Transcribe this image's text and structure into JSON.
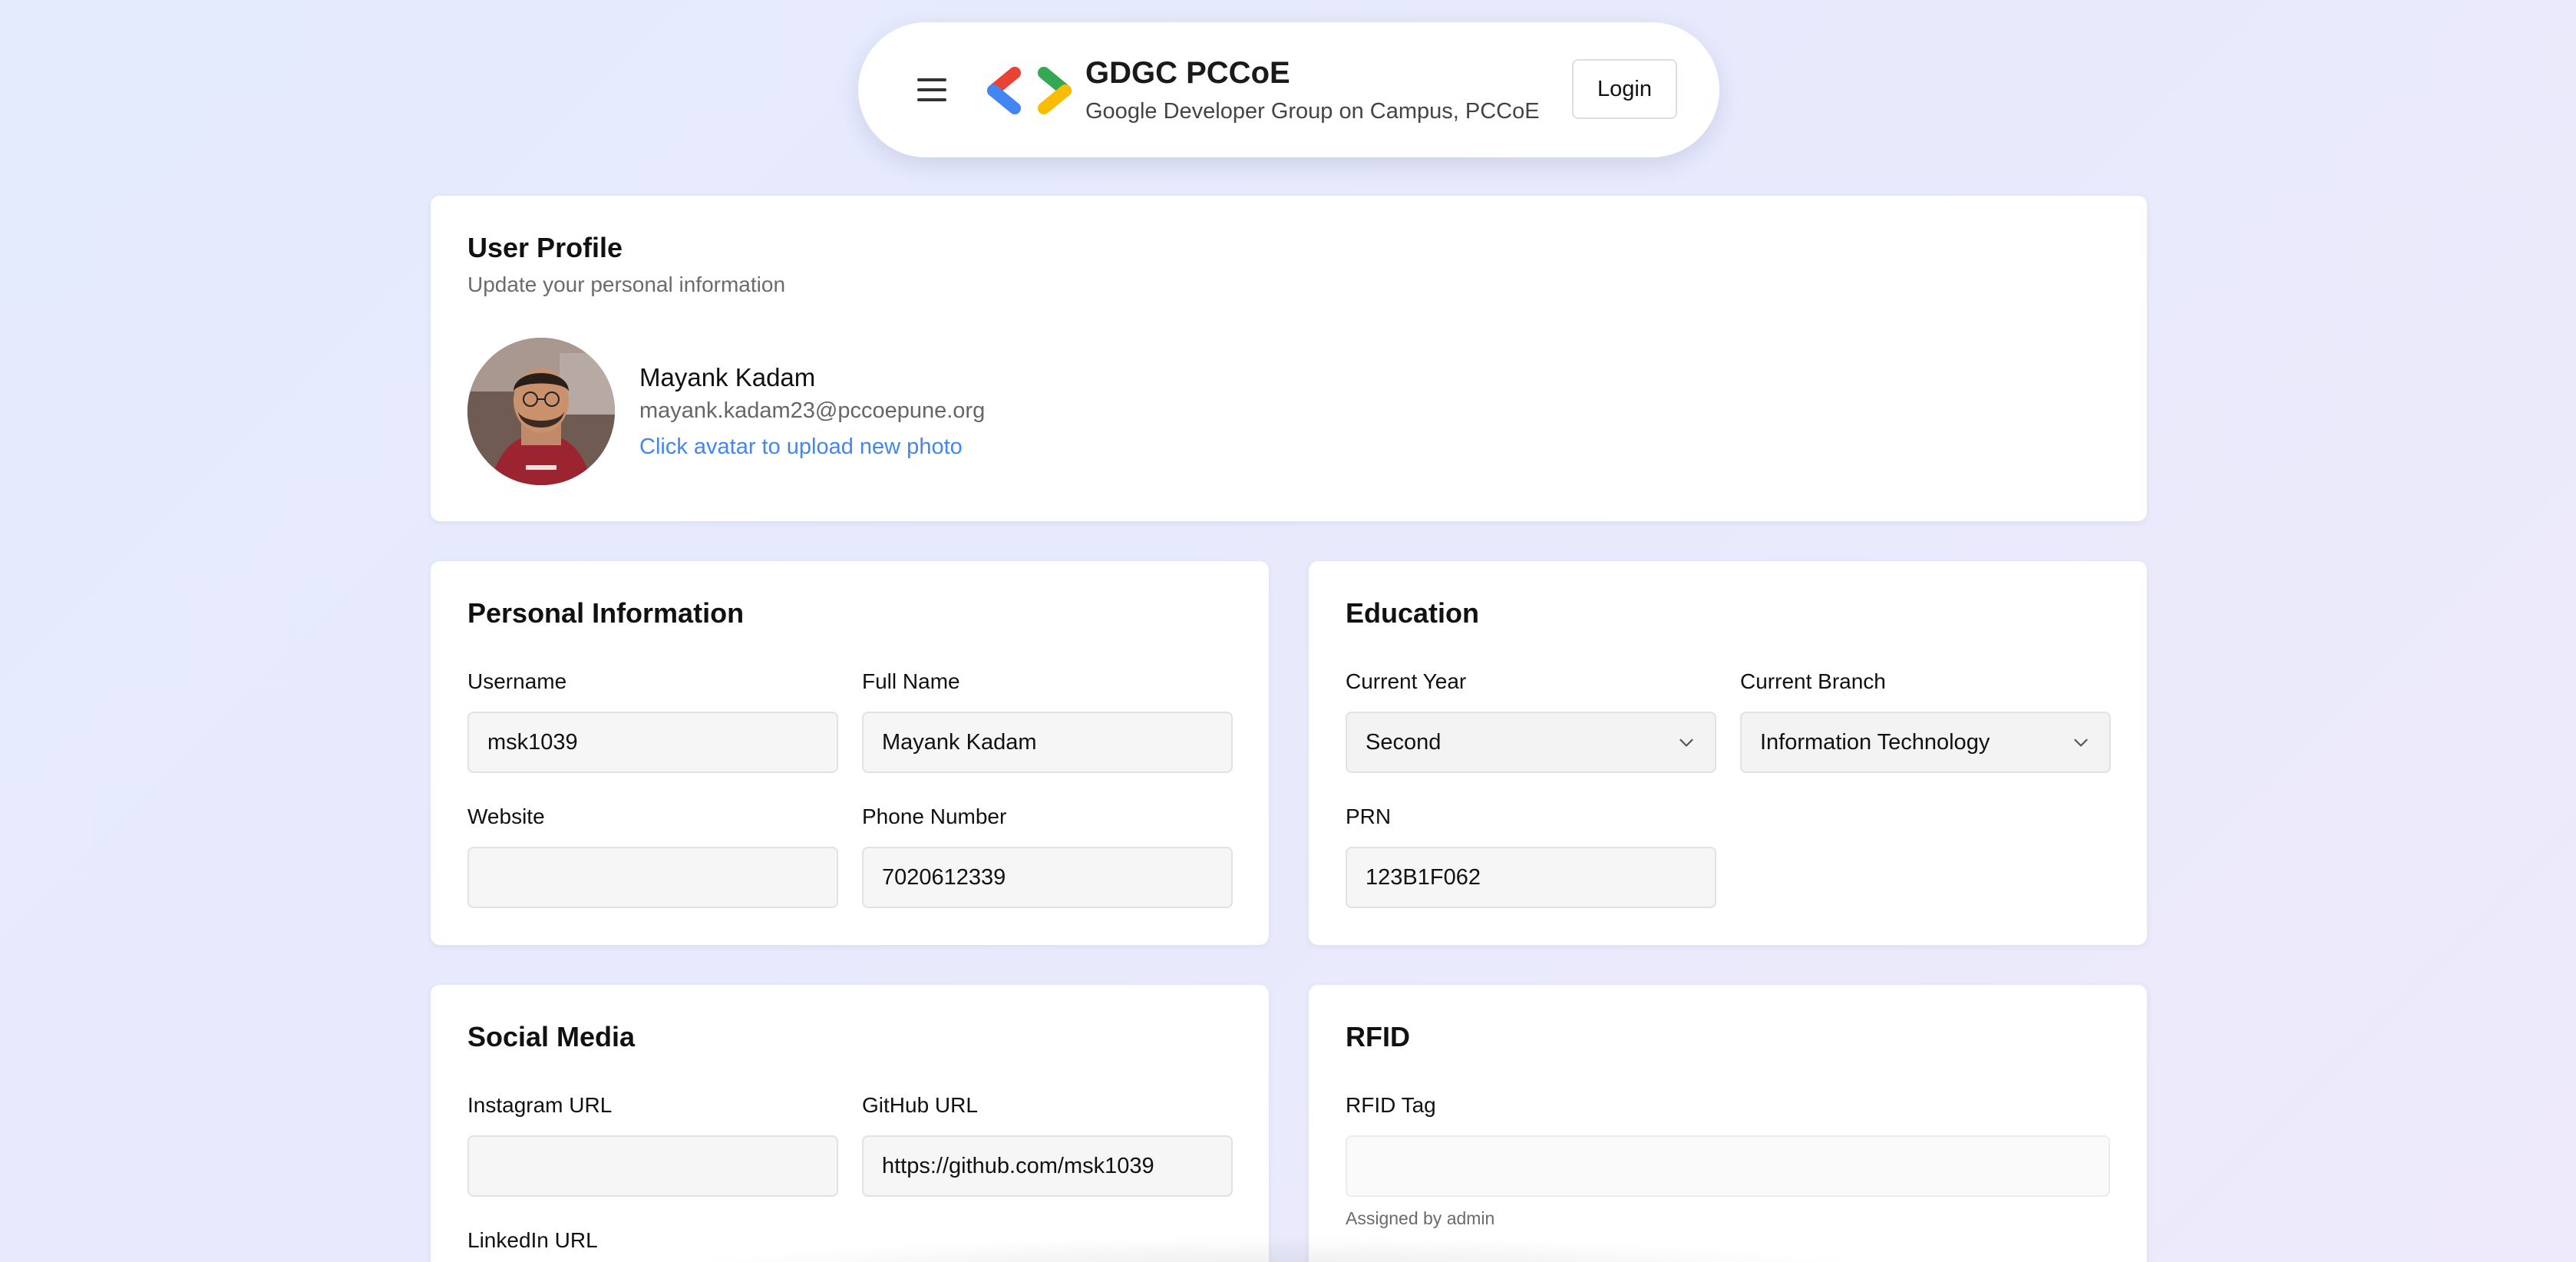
{
  "header": {
    "title": "GDGC PCCoE",
    "subtitle": "Google Developer Group on Campus, PCCoE",
    "login_label": "Login",
    "logo_colors": [
      "#4285f4",
      "#ea4335",
      "#34a853",
      "#fbbc04"
    ]
  },
  "profile": {
    "title": "User Profile",
    "subtitle": "Update your personal information",
    "name": "Mayank Kadam",
    "email": "mayank.kadam23@pccoepune.org",
    "hint": "Click avatar to upload new photo"
  },
  "personal": {
    "title": "Personal Information",
    "username_label": "Username",
    "username_value": "msk1039",
    "fullname_label": "Full Name",
    "fullname_value": "Mayank Kadam",
    "website_label": "Website",
    "website_value": "",
    "phone_label": "Phone Number",
    "phone_value": "7020612339"
  },
  "education": {
    "title": "Education",
    "year_label": "Current Year",
    "year_value": "Second",
    "branch_label": "Current Branch",
    "branch_value": "Information Technology",
    "prn_label": "PRN",
    "prn_value": "123B1F062"
  },
  "social": {
    "title": "Social Media",
    "instagram_label": "Instagram URL",
    "instagram_value": "",
    "github_label": "GitHub URL",
    "github_value": "https://github.com/msk1039",
    "linkedin_label": "LinkedIn URL"
  },
  "rfid": {
    "title": "RFID",
    "tag_label": "RFID Tag",
    "tag_value": "",
    "note": "Assigned by admin"
  },
  "colors": {
    "accent_link": "#4285f4",
    "page_bg": "#e6ebfc"
  }
}
